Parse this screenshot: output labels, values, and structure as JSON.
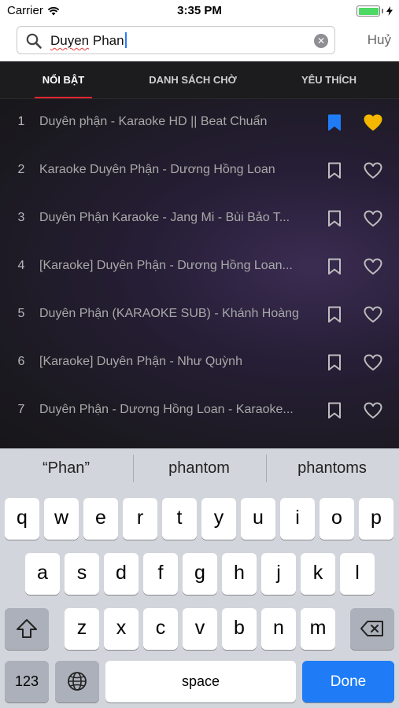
{
  "status_bar": {
    "carrier": "Carrier",
    "time": "3:35 PM",
    "battery_level": 1.0
  },
  "search": {
    "query_misspelled": "Duyen",
    "query_rest": " Phan",
    "cancel_label": "Huỷ"
  },
  "tabs": [
    {
      "label": "NỔI BẬT",
      "active": true
    },
    {
      "label": "DANH SÁCH CHỜ",
      "active": false
    },
    {
      "label": "YÊU THÍCH",
      "active": false
    }
  ],
  "results": [
    {
      "num": "1",
      "title": "Duyên phận - Karaoke HD || Beat Chuẩn",
      "bookmarked": true,
      "favorited": true
    },
    {
      "num": "2",
      "title": "Karaoke Duyên Phận - Dương Hồng Loan",
      "bookmarked": false,
      "favorited": false
    },
    {
      "num": "3",
      "title": "Duyên Phận Karaoke - Jang Mi - Bùi Bảo T...",
      "bookmarked": false,
      "favorited": false
    },
    {
      "num": "4",
      "title": "[Karaoke] Duyên Phận - Dương Hồng Loan...",
      "bookmarked": false,
      "favorited": false
    },
    {
      "num": "5",
      "title": "Duyên Phận (KARAOKE SUB) - Khánh Hoàng",
      "bookmarked": false,
      "favorited": false
    },
    {
      "num": "6",
      "title": "[Karaoke] Duyên Phận - Như Quỳnh",
      "bookmarked": false,
      "favorited": false
    },
    {
      "num": "7",
      "title": "Duyên Phận - Dương Hồng Loan - Karaoke...",
      "bookmarked": false,
      "favorited": false
    }
  ],
  "keyboard": {
    "suggestions": [
      "“Phan”",
      "phantom",
      "phantoms"
    ],
    "row1": [
      "q",
      "w",
      "e",
      "r",
      "t",
      "y",
      "u",
      "i",
      "o",
      "p"
    ],
    "row2": [
      "a",
      "s",
      "d",
      "f",
      "g",
      "h",
      "j",
      "k",
      "l"
    ],
    "row3": [
      "z",
      "x",
      "c",
      "v",
      "b",
      "n",
      "m"
    ],
    "numbers_label": "123",
    "space_label": "space",
    "done_label": "Done"
  },
  "colors": {
    "accent_tab_underline": "#e3262e",
    "bookmark_active": "#1f7cf6",
    "favorite_active": "#f5b700",
    "done_key": "#1f7cf6"
  },
  "icons": [
    "wifi-icon",
    "battery-icon",
    "search-icon",
    "clear-icon",
    "bookmark-icon",
    "heart-icon",
    "shift-icon",
    "globe-icon",
    "backspace-icon"
  ]
}
